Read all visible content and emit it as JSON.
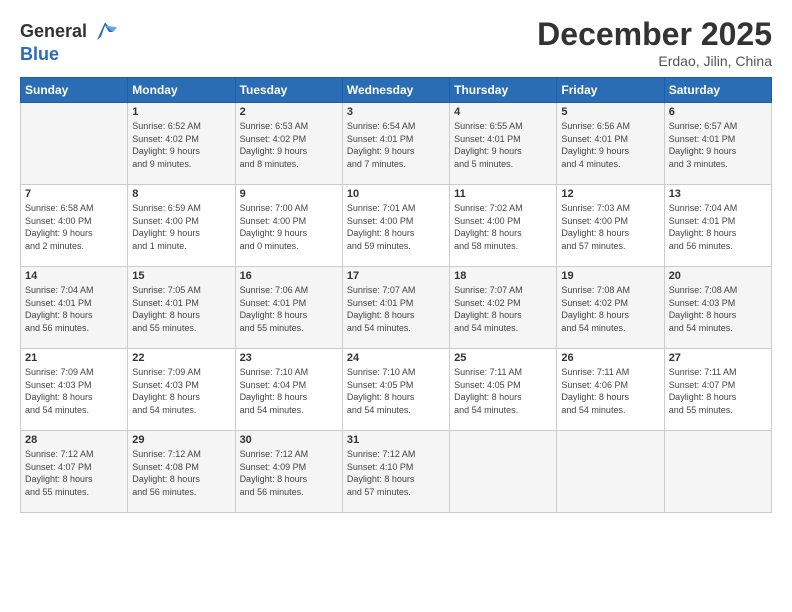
{
  "header": {
    "logo_line1": "General",
    "logo_line2": "Blue",
    "title": "December 2025",
    "subtitle": "Erdao, Jilin, China"
  },
  "columns": [
    "Sunday",
    "Monday",
    "Tuesday",
    "Wednesday",
    "Thursday",
    "Friday",
    "Saturday"
  ],
  "weeks": [
    [
      {
        "day": "",
        "info": ""
      },
      {
        "day": "1",
        "info": "Sunrise: 6:52 AM\nSunset: 4:02 PM\nDaylight: 9 hours\nand 9 minutes."
      },
      {
        "day": "2",
        "info": "Sunrise: 6:53 AM\nSunset: 4:02 PM\nDaylight: 9 hours\nand 8 minutes."
      },
      {
        "day": "3",
        "info": "Sunrise: 6:54 AM\nSunset: 4:01 PM\nDaylight: 9 hours\nand 7 minutes."
      },
      {
        "day": "4",
        "info": "Sunrise: 6:55 AM\nSunset: 4:01 PM\nDaylight: 9 hours\nand 5 minutes."
      },
      {
        "day": "5",
        "info": "Sunrise: 6:56 AM\nSunset: 4:01 PM\nDaylight: 9 hours\nand 4 minutes."
      },
      {
        "day": "6",
        "info": "Sunrise: 6:57 AM\nSunset: 4:01 PM\nDaylight: 9 hours\nand 3 minutes."
      }
    ],
    [
      {
        "day": "7",
        "info": "Sunrise: 6:58 AM\nSunset: 4:00 PM\nDaylight: 9 hours\nand 2 minutes."
      },
      {
        "day": "8",
        "info": "Sunrise: 6:59 AM\nSunset: 4:00 PM\nDaylight: 9 hours\nand 1 minute."
      },
      {
        "day": "9",
        "info": "Sunrise: 7:00 AM\nSunset: 4:00 PM\nDaylight: 9 hours\nand 0 minutes."
      },
      {
        "day": "10",
        "info": "Sunrise: 7:01 AM\nSunset: 4:00 PM\nDaylight: 8 hours\nand 59 minutes."
      },
      {
        "day": "11",
        "info": "Sunrise: 7:02 AM\nSunset: 4:00 PM\nDaylight: 8 hours\nand 58 minutes."
      },
      {
        "day": "12",
        "info": "Sunrise: 7:03 AM\nSunset: 4:00 PM\nDaylight: 8 hours\nand 57 minutes."
      },
      {
        "day": "13",
        "info": "Sunrise: 7:04 AM\nSunset: 4:01 PM\nDaylight: 8 hours\nand 56 minutes."
      }
    ],
    [
      {
        "day": "14",
        "info": "Sunrise: 7:04 AM\nSunset: 4:01 PM\nDaylight: 8 hours\nand 56 minutes."
      },
      {
        "day": "15",
        "info": "Sunrise: 7:05 AM\nSunset: 4:01 PM\nDaylight: 8 hours\nand 55 minutes."
      },
      {
        "day": "16",
        "info": "Sunrise: 7:06 AM\nSunset: 4:01 PM\nDaylight: 8 hours\nand 55 minutes."
      },
      {
        "day": "17",
        "info": "Sunrise: 7:07 AM\nSunset: 4:01 PM\nDaylight: 8 hours\nand 54 minutes."
      },
      {
        "day": "18",
        "info": "Sunrise: 7:07 AM\nSunset: 4:02 PM\nDaylight: 8 hours\nand 54 minutes."
      },
      {
        "day": "19",
        "info": "Sunrise: 7:08 AM\nSunset: 4:02 PM\nDaylight: 8 hours\nand 54 minutes."
      },
      {
        "day": "20",
        "info": "Sunrise: 7:08 AM\nSunset: 4:03 PM\nDaylight: 8 hours\nand 54 minutes."
      }
    ],
    [
      {
        "day": "21",
        "info": "Sunrise: 7:09 AM\nSunset: 4:03 PM\nDaylight: 8 hours\nand 54 minutes."
      },
      {
        "day": "22",
        "info": "Sunrise: 7:09 AM\nSunset: 4:03 PM\nDaylight: 8 hours\nand 54 minutes."
      },
      {
        "day": "23",
        "info": "Sunrise: 7:10 AM\nSunset: 4:04 PM\nDaylight: 8 hours\nand 54 minutes."
      },
      {
        "day": "24",
        "info": "Sunrise: 7:10 AM\nSunset: 4:05 PM\nDaylight: 8 hours\nand 54 minutes."
      },
      {
        "day": "25",
        "info": "Sunrise: 7:11 AM\nSunset: 4:05 PM\nDaylight: 8 hours\nand 54 minutes."
      },
      {
        "day": "26",
        "info": "Sunrise: 7:11 AM\nSunset: 4:06 PM\nDaylight: 8 hours\nand 54 minutes."
      },
      {
        "day": "27",
        "info": "Sunrise: 7:11 AM\nSunset: 4:07 PM\nDaylight: 8 hours\nand 55 minutes."
      }
    ],
    [
      {
        "day": "28",
        "info": "Sunrise: 7:12 AM\nSunset: 4:07 PM\nDaylight: 8 hours\nand 55 minutes."
      },
      {
        "day": "29",
        "info": "Sunrise: 7:12 AM\nSunset: 4:08 PM\nDaylight: 8 hours\nand 56 minutes."
      },
      {
        "day": "30",
        "info": "Sunrise: 7:12 AM\nSunset: 4:09 PM\nDaylight: 8 hours\nand 56 minutes."
      },
      {
        "day": "31",
        "info": "Sunrise: 7:12 AM\nSunset: 4:10 PM\nDaylight: 8 hours\nand 57 minutes."
      },
      {
        "day": "",
        "info": ""
      },
      {
        "day": "",
        "info": ""
      },
      {
        "day": "",
        "info": ""
      }
    ]
  ]
}
